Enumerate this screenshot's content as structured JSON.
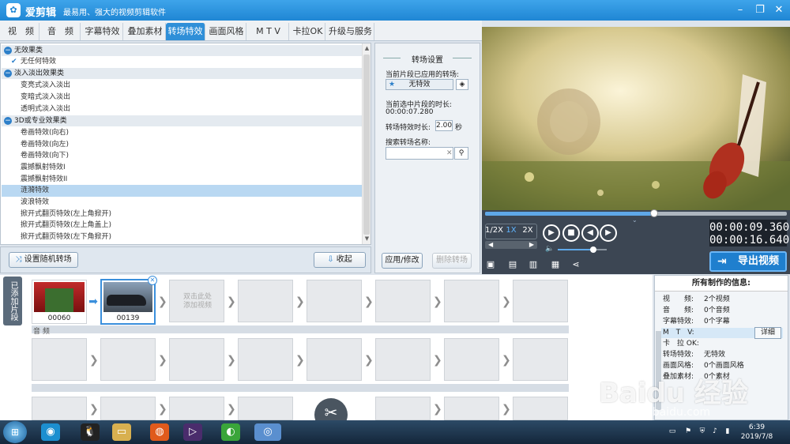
{
  "app": {
    "name": "爱剪辑",
    "slogan": "最易用、强大的视频剪辑软件"
  },
  "tabs": [
    "视　频",
    "音　频",
    "字幕特效",
    "叠加素材",
    "转场特效",
    "画面风格",
    "M T V",
    "卡拉OK",
    "升级与服务"
  ],
  "active_tab": "转场特效",
  "effect_list": {
    "categories": [
      {
        "name": "无效果类",
        "items": [
          "无任何特效"
        ]
      },
      {
        "name": "淡入淡出效果类",
        "items": [
          "变亮式淡入淡出",
          "变暗式淡入淡出",
          "透明式淡入淡出"
        ]
      },
      {
        "name": "3D或专业效果类",
        "items": [
          "卷画特效(向右)",
          "卷画特效(向左)",
          "卷画特效(向下)",
          "震撼飘射特效I",
          "震撼飘射特效II",
          "涟漪特效",
          "波浪特效",
          "掀开式翻页特效(左上角掀开)",
          "掀开式翻页特效(左上角盖上)",
          "掀开式翻页特效(左下角掀开)"
        ]
      }
    ],
    "checked_item": "无任何特效",
    "selected_item": "涟漪特效"
  },
  "list_buttons": {
    "random": "设置随机转场",
    "collapse": "收起"
  },
  "settings": {
    "title": "转场设置",
    "applied_label": "当前片段已应用的转场:",
    "applied_value": "无特效",
    "duration_label": "当前选中片段的时长:",
    "duration_value": "00:00:07.280",
    "effect_duration_label": "转场特效时长:",
    "effect_duration_value": "2.00",
    "effect_duration_unit": "秒",
    "search_label": "搜索转场名称:",
    "search_value": "",
    "apply_button": "应用/修改",
    "delete_button": "删除转场"
  },
  "player": {
    "speeds": [
      "1/2X",
      "1X",
      "2X"
    ],
    "current_time": "00:00:09.360",
    "total_time": "00:00:16.640",
    "progress": 0.56,
    "volume": 0.72,
    "export_label": "导出视频"
  },
  "timeline": {
    "side_label": "已添加片段",
    "clips": [
      "00060",
      "00139"
    ],
    "add_hint": "双击此处\n添加视频",
    "audio_label": "音 频"
  },
  "info": {
    "title": "所有制作的信息:",
    "rows": [
      {
        "k": "视　　频:",
        "v": "2个视频"
      },
      {
        "k": "音　　频:",
        "v": "0个音频"
      },
      {
        "k": "字幕特效:",
        "v": "0个字幕"
      },
      {
        "k": "M　T　V:",
        "v": ""
      },
      {
        "k": "卡　拉 OK:",
        "v": ""
      },
      {
        "k": "转场特效:",
        "v": "无特效"
      },
      {
        "k": "画面风格:",
        "v": "0个画面风格"
      },
      {
        "k": "叠加素材:",
        "v": "0个素材"
      }
    ],
    "detail_button": "详细"
  },
  "taskbar": {
    "time": "6:39",
    "date": "2019/7/8"
  },
  "watermark": {
    "line1": "Baidu 经验",
    "line2": "jingyan.baidu.com"
  },
  "colors": {
    "accent": "#2f8fd8",
    "selection": "#b9d8f2",
    "titlebar": "#1f86d4"
  }
}
